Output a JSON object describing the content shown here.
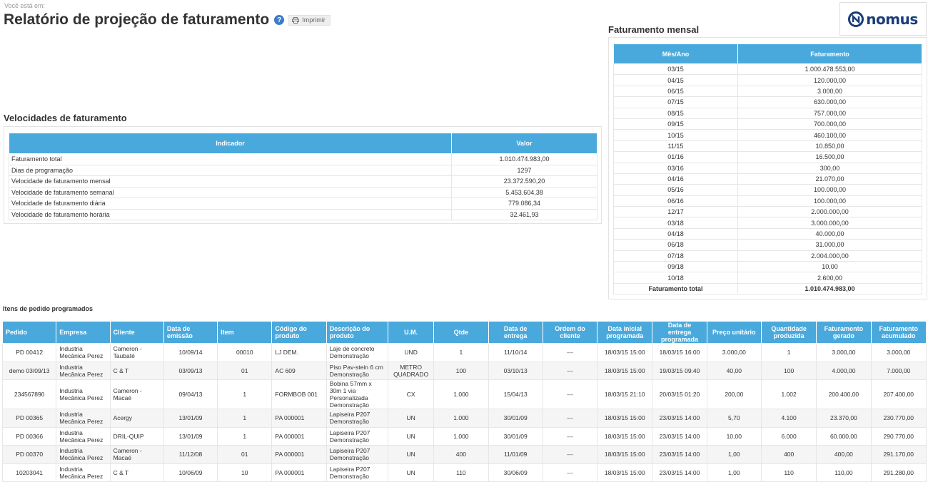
{
  "breadcrumb": "Você está em:",
  "page_title": "Relatório de projeção de faturamento",
  "help_label": "?",
  "print_label": "Imprimir",
  "logo_text": "nomus",
  "velocidades": {
    "title": "Velocidades de faturamento",
    "headers": [
      "Indicador",
      "Valor"
    ],
    "rows": [
      [
        "Faturamento total",
        "1.010.474.983,00"
      ],
      [
        "Dias de programação",
        "1297"
      ],
      [
        "Velocidade de faturamento mensal",
        "23.372.590,20"
      ],
      [
        "Velocidade de faturamento semanal",
        "5.453.604,38"
      ],
      [
        "Velocidade de faturamento diária",
        "779.086,34"
      ],
      [
        "Velocidade de faturamento horária",
        "32.461,93"
      ]
    ]
  },
  "faturamento_mensal": {
    "title": "Faturamento mensal",
    "headers": [
      "Mês/Ano",
      "Faturamento"
    ],
    "rows": [
      [
        "03/15",
        "1.000.478.553,00"
      ],
      [
        "04/15",
        "120.000,00"
      ],
      [
        "06/15",
        "3.000,00"
      ],
      [
        "07/15",
        "630.000,00"
      ],
      [
        "08/15",
        "757.000,00"
      ],
      [
        "09/15",
        "700.000,00"
      ],
      [
        "10/15",
        "460.100,00"
      ],
      [
        "11/15",
        "10.850,00"
      ],
      [
        "01/16",
        "16.500,00"
      ],
      [
        "03/16",
        "300,00"
      ],
      [
        "04/16",
        "21.070,00"
      ],
      [
        "05/16",
        "100.000,00"
      ],
      [
        "06/16",
        "100.000,00"
      ],
      [
        "12/17",
        "2.000.000,00"
      ],
      [
        "03/18",
        "3.000.000,00"
      ],
      [
        "04/18",
        "40.000,00"
      ],
      [
        "06/18",
        "31.000,00"
      ],
      [
        "07/18",
        "2.004.000,00"
      ],
      [
        "09/18",
        "10,00"
      ],
      [
        "10/18",
        "2.600,00"
      ]
    ],
    "total_label": "Faturamento total",
    "total_value": "1.010.474.983,00"
  },
  "itens": {
    "title": "Itens de pedido programados",
    "headers": [
      "Pedido",
      "Empresa",
      "Cliente",
      "Data de emissão",
      "Item",
      "Código do produto",
      "Descrição do produto",
      "U.M.",
      "Qtde",
      "Data de entrega",
      "Ordem do cliente",
      "Data inicial programada",
      "Data de entrega programada",
      "Preço unitário",
      "Quantidade produzida",
      "Faturamento gerado",
      "Faturamento acumulado"
    ],
    "rows": [
      [
        "PD 00412",
        "Industria Mecânica Perez",
        "Cameron - Taubaté",
        "10/09/14",
        "00010",
        "LJ DEM.",
        "Laje de concreto Demonstração",
        "UND",
        "1",
        "11/10/14",
        "---",
        "18/03/15 15:00",
        "18/03/15 16:00",
        "3.000,00",
        "1",
        "3.000,00",
        "3.000,00"
      ],
      [
        "demo 03/09/13",
        "Industria Mecânica Perez",
        "C & T",
        "03/09/13",
        "01",
        "AC 609",
        "Piso Pav-stein 6 cm Demonstração",
        "METRO QUADRADO",
        "100",
        "03/10/13",
        "---",
        "18/03/15 15:00",
        "19/03/15 09:40",
        "40,00",
        "100",
        "4.000,00",
        "7.000,00"
      ],
      [
        "234567890",
        "Industria Mecânica Perez",
        "Cameron - Macaé",
        "09/04/13",
        "1",
        "FORMBOB 001",
        "Bobina 57mm x 30m 1 via Personalizada Demonstração",
        "CX",
        "1.000",
        "15/04/13",
        "---",
        "18/03/15 21:10",
        "20/03/15 01:20",
        "200,00",
        "1.002",
        "200.400,00",
        "207.400,00"
      ],
      [
        "PD 00365",
        "Industria Mecânica Perez",
        "Acergy",
        "13/01/09",
        "1",
        "PA 000001",
        "Lapiseira P207 Demonstração",
        "UN",
        "1.000",
        "30/01/09",
        "---",
        "18/03/15 15:00",
        "23/03/15 14:00",
        "5,70",
        "4.100",
        "23.370,00",
        "230.770,00"
      ],
      [
        "PD 00366",
        "Industria Mecânica Perez",
        "DRIL-QUIP",
        "13/01/09",
        "1",
        "PA 000001",
        "Lapiseira P207 Demonstração",
        "UN",
        "1.000",
        "30/01/09",
        "---",
        "18/03/15 15:00",
        "23/03/15 14:00",
        "10,00",
        "6.000",
        "60.000,00",
        "290.770,00"
      ],
      [
        "PD 00370",
        "Industria Mecânica Perez",
        "Cameron - Macaé",
        "11/12/08",
        "01",
        "PA 000001",
        "Lapiseira P207 Demonstração",
        "UN",
        "400",
        "11/01/09",
        "---",
        "18/03/15 15:00",
        "23/03/15 14:00",
        "1,00",
        "400",
        "400,00",
        "291.170,00"
      ],
      [
        "10203041",
        "Industria Mecânica Perez",
        "C & T",
        "10/06/09",
        "10",
        "PA 000001",
        "Lapiseira P207 Demonstração",
        "UN",
        "110",
        "30/06/09",
        "---",
        "18/03/15 15:00",
        "23/03/15 14:00",
        "1,00",
        "110",
        "110,00",
        "291.280,00"
      ]
    ]
  }
}
